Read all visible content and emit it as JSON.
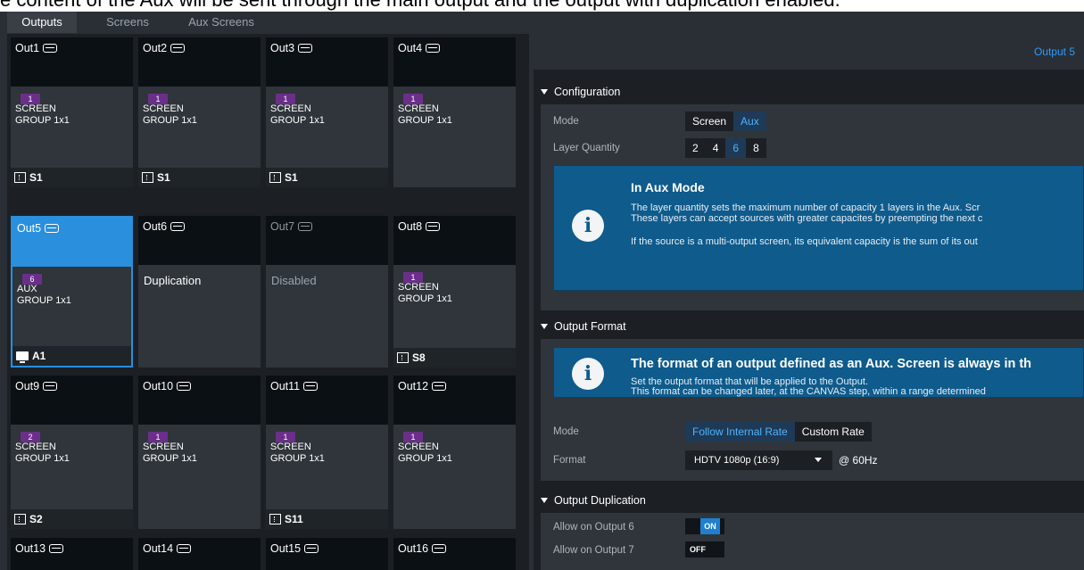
{
  "caption": "e content of the Aux will be sent through the main output and the output with duplication enabled.",
  "tabs": [
    "Outputs",
    "Screens",
    "Aux Screens"
  ],
  "colors": {
    "accent": "#2a8fdd",
    "badge": "#6b2f8a",
    "info": "#0e5b8c",
    "link": "#2a9bff"
  },
  "outputs": [
    {
      "title": "Out1",
      "badge": "1",
      "type": "SCREEN",
      "group": "GROUP 1x1",
      "footer": "S1",
      "footer_icon": "screen-group-icon"
    },
    {
      "title": "Out2",
      "badge": "1",
      "type": "SCREEN",
      "group": "GROUP 1x1",
      "footer": "S1",
      "footer_icon": "screen-group-icon"
    },
    {
      "title": "Out3",
      "badge": "1",
      "type": "SCREEN",
      "group": "GROUP 1x1",
      "footer": "S1",
      "footer_icon": "screen-group-icon"
    },
    {
      "title": "Out4",
      "badge": "1",
      "type": "SCREEN",
      "group": "GROUP 1x1",
      "footer": "",
      "footer_icon": ""
    },
    {
      "title": "Out5",
      "badge": "6",
      "type": "AUX",
      "group": "GROUP 1x1",
      "footer": "A1",
      "footer_icon": "monitor-icon",
      "selected": true
    },
    {
      "title": "Out6",
      "status": "Duplication"
    },
    {
      "title": "Out7",
      "status": "Disabled",
      "dim": true
    },
    {
      "title": "Out8",
      "badge": "1",
      "type": "SCREEN",
      "group": "GROUP 1x1",
      "footer": "S8",
      "footer_icon": "screen-group-icon"
    },
    {
      "title": "Out9",
      "badge": "2",
      "type": "SCREEN",
      "group": "GROUP 1x1",
      "footer": "S2",
      "footer_icon": "screen-group-icon"
    },
    {
      "title": "Out10",
      "badge": "1",
      "type": "SCREEN",
      "group": "GROUP 1x1",
      "footer": "",
      "footer_icon": ""
    },
    {
      "title": "Out11",
      "badge": "1",
      "type": "SCREEN",
      "group": "GROUP 1x1",
      "footer": "S11",
      "footer_icon": "screen-group-icon"
    },
    {
      "title": "Out12",
      "badge": "1",
      "type": "SCREEN",
      "group": "GROUP 1x1",
      "footer": "",
      "footer_icon": ""
    },
    {
      "title": "Out13"
    },
    {
      "title": "Out14"
    },
    {
      "title": "Out15"
    },
    {
      "title": "Out16"
    }
  ],
  "panel": {
    "title": "Output 5",
    "configuration": {
      "header": "Configuration",
      "mode_label": "Mode",
      "mode_options": [
        "Screen",
        "Aux"
      ],
      "mode_selected": "Aux",
      "layer_label": "Layer Quantity",
      "layer_options": [
        "2",
        "4",
        "6",
        "8"
      ],
      "layer_selected": "6",
      "info_title": "In Aux Mode",
      "info_line1": "The layer quantity sets the maximum number of capacity 1 layers in the Aux. Scr",
      "info_line2": "These layers can accept sources with greater capacites by preempting the next c",
      "info_line3": "If the source is a multi-output screen, its equivalent capacity is the sum of its out"
    },
    "output_format": {
      "header": "Output Format",
      "info_title": "The format of an output defined as an Aux. Screen is always in th",
      "info_line1": "Set the output format that will be applied to the Output.",
      "info_line2": "This format can be changed later, at the CANVAS step, within a range determined",
      "mode_label": "Mode",
      "mode_options": [
        "Follow Internal Rate",
        "Custom Rate"
      ],
      "mode_selected": "Follow Internal Rate",
      "format_label": "Format",
      "format_value": "HDTV 1080p (16:9)",
      "rate": "@ 60Hz"
    },
    "duplication": {
      "header": "Output Duplication",
      "allow6_label": "Allow on Output 6",
      "allow6_value": "ON",
      "allow7_label": "Allow on Output 7",
      "allow7_value": "OFF"
    }
  }
}
